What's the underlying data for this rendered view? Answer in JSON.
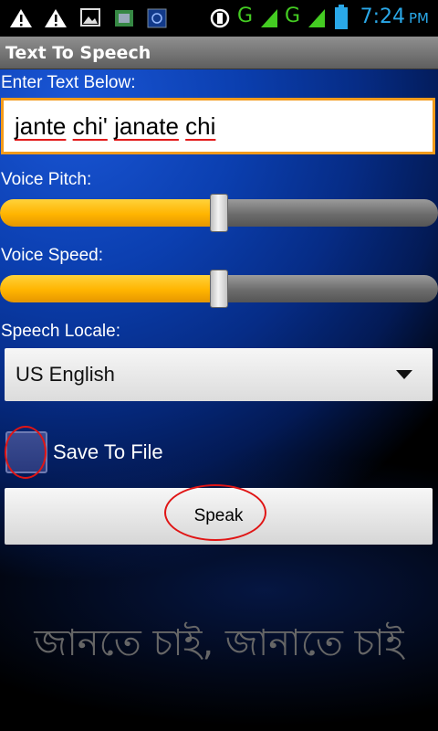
{
  "status_bar": {
    "time": "7:24",
    "ampm": "PM",
    "network_labels": [
      "G",
      "G"
    ],
    "accent_color": "#2aa8e8"
  },
  "app": {
    "title": "Text To Speech"
  },
  "form": {
    "text_label": "Enter Text Below:",
    "text_words": [
      "jante",
      "chi'",
      "janate",
      "chi"
    ],
    "pitch_label": "Voice Pitch:",
    "pitch_level": 0.5,
    "speed_label": "Voice Speed:",
    "speed_level": 0.5,
    "locale_label": "Speech Locale:",
    "locale_value": "US English",
    "save_label": "Save To File",
    "save_checked": false,
    "speak_label": "Speak"
  },
  "banner": {
    "text": "জানতে চাই, জানাতে চাই"
  }
}
